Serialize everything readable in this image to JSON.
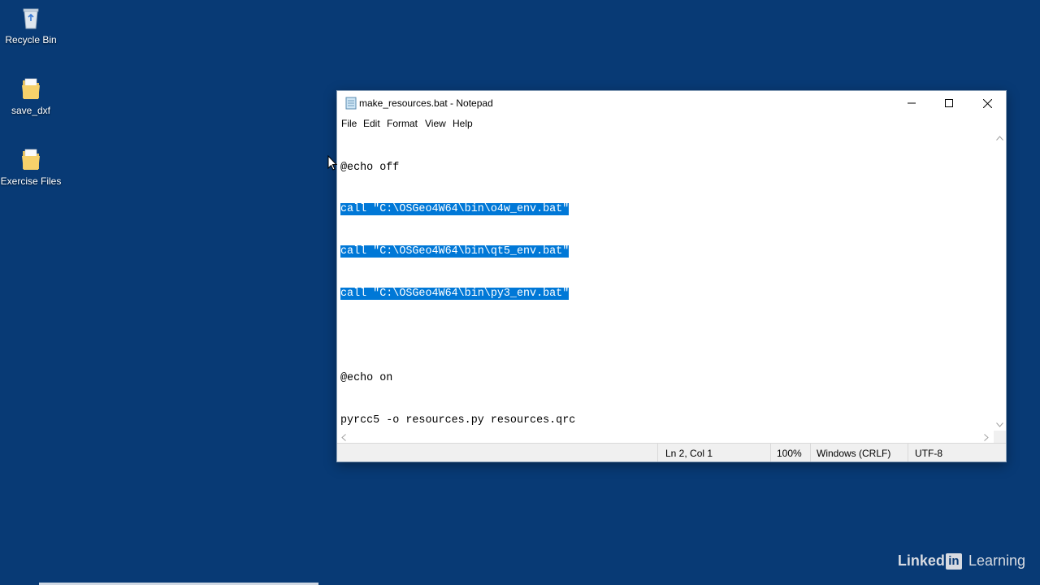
{
  "desktop": {
    "icons": [
      {
        "label": "Recycle Bin",
        "icon": "recycle-bin-icon"
      },
      {
        "label": "save_dxf",
        "icon": "folder-icon"
      },
      {
        "label": "Exercise Files",
        "icon": "folder-icon"
      }
    ]
  },
  "window": {
    "title": "make_resources.bat - Notepad",
    "app_icon": "notepad-icon",
    "controls": [
      "minimize-icon",
      "maximize-icon",
      "close-icon"
    ]
  },
  "menu": {
    "items": [
      "File",
      "Edit",
      "Format",
      "View",
      "Help"
    ]
  },
  "editor": {
    "lines": [
      "@echo off",
      "call \"C:\\OSGeo4W64\\bin\\o4w_env.bat\"",
      "call \"C:\\OSGeo4W64\\bin\\qt5_env.bat\"",
      "call \"C:\\OSGeo4W64\\bin\\py3_env.bat\"",
      "",
      "@echo on",
      "pyrcc5 -o resources.py resources.qrc"
    ],
    "selected_lines": [
      1,
      2,
      3
    ],
    "selection_color": "#0078d7"
  },
  "status": {
    "position": "Ln 2, Col 1",
    "zoom": "100%",
    "line_ending": "Windows (CRLF)",
    "encoding": "UTF-8"
  },
  "watermark": {
    "brand_a": "Linked",
    "brand_in": "in",
    "brand_b": "Learning"
  },
  "colors": {
    "desktop_bg": "#083a75",
    "selection": "#0078d7"
  }
}
